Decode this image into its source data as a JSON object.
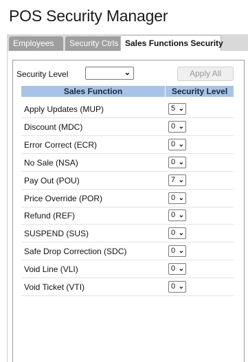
{
  "app": {
    "title": "POS Security Manager"
  },
  "tabs": [
    {
      "label": "Employees",
      "active": false
    },
    {
      "label": "Security Ctrls",
      "active": false
    },
    {
      "label": "Sales Functions Security",
      "active": true
    }
  ],
  "toolbar": {
    "security_level_label": "Security Level",
    "security_level_value": "",
    "apply_all_label": "Apply All"
  },
  "table": {
    "headers": {
      "function": "Sales Function",
      "level": "Security Level"
    },
    "rows": [
      {
        "function": "Apply Updates (MUP)",
        "level": "5"
      },
      {
        "function": "Discount (MDC)",
        "level": "0"
      },
      {
        "function": "Error Correct (ECR)",
        "level": "0"
      },
      {
        "function": "No Sale (NSA)",
        "level": "0"
      },
      {
        "function": "Pay Out (POU)",
        "level": "7"
      },
      {
        "function": "Price Override (POR)",
        "level": "0"
      },
      {
        "function": "Refund (REF)",
        "level": "0"
      },
      {
        "function": "SUSPEND (SUS)",
        "level": "0"
      },
      {
        "function": "Safe Drop Correction (SDC)",
        "level": "0"
      },
      {
        "function": "Void Line (VLI)",
        "level": "0"
      },
      {
        "function": "Void Ticket (VTI)",
        "level": "0"
      }
    ]
  },
  "icons": {
    "dropdown": "chevron-down-icon"
  },
  "colors": {
    "tab_inactive": "#9e9e9e",
    "tab_bar": "#d9d9d9",
    "table_header": "#a8c3e6",
    "disabled_text": "#9a9a9a"
  }
}
